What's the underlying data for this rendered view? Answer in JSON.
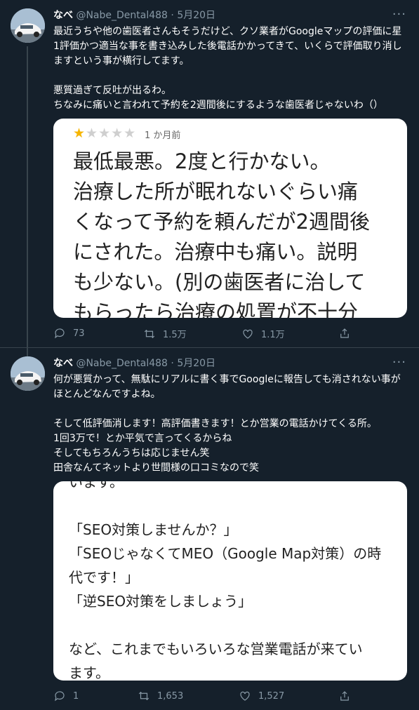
{
  "tweets": [
    {
      "name": "なべ",
      "handle": "@Nabe_Dental488",
      "sep": "·",
      "date": "5月20日",
      "text": "最近うちや他の歯医者さんもそうだけど、クソ業者がGoogleマップの評価に星1評価かつ適当な事を書き込みした後電話かかってきて、いくらで評価取り消しますという事が横行してます。\n\n悪質過ぎて反吐が出るわ。\nちなみに痛いと言われて予約を2週間後にするような歯医者じゃないわ（）",
      "image": {
        "stars_filled": "★",
        "stars_empty": "★★★★",
        "ago": "1 か月前",
        "review": "最低最悪。2度と行かない。\n治療した所が眠れないぐらい痛\nくなって予約を頼んだが2週間後\nにされた。治療中も痛い。説明\nも少ない。(別の歯医者に治して\nもらったら治療の処置が不十分"
      },
      "replies": "73",
      "retweets": "1.5万",
      "likes": "1.1万"
    },
    {
      "name": "なべ",
      "handle": "@Nabe_Dental488",
      "sep": "·",
      "date": "5月20日",
      "text": "何が悪質かって、無駄にリアルに書く事でGoogleに報告しても消されない事がほとんどなんですよね。\n\nそして低評価消します！高評価書きます！とか営業の電話かけてくる所。\n1回3万で！とか平気で言ってくるからね\nそしてもちろんうちは応じません笑\n田舎なんてネットより世間様の口コミなので笑",
      "image": {
        "body": "います。\n\n「SEO対策しませんか？」\n「SEOじゃなくてMEO（Google Map対策）の時\n代です！」\n「逆SEO対策をしましょう」\n\nなど、これまでもいろいろな営業電話が来てい\nます。\n心配になってしまう院長先生も多いと思います"
      },
      "replies": "1",
      "retweets": "1,653",
      "likes": "1,527"
    }
  ],
  "icons": {
    "reply": "reply-icon",
    "retweet": "retweet-icon",
    "like": "heart-icon",
    "share": "share-icon",
    "more": "more-icon"
  },
  "colors": {
    "background": "#15202b",
    "divider": "#38444d",
    "secondary_text": "#8899a6",
    "star": "#f6b500"
  }
}
